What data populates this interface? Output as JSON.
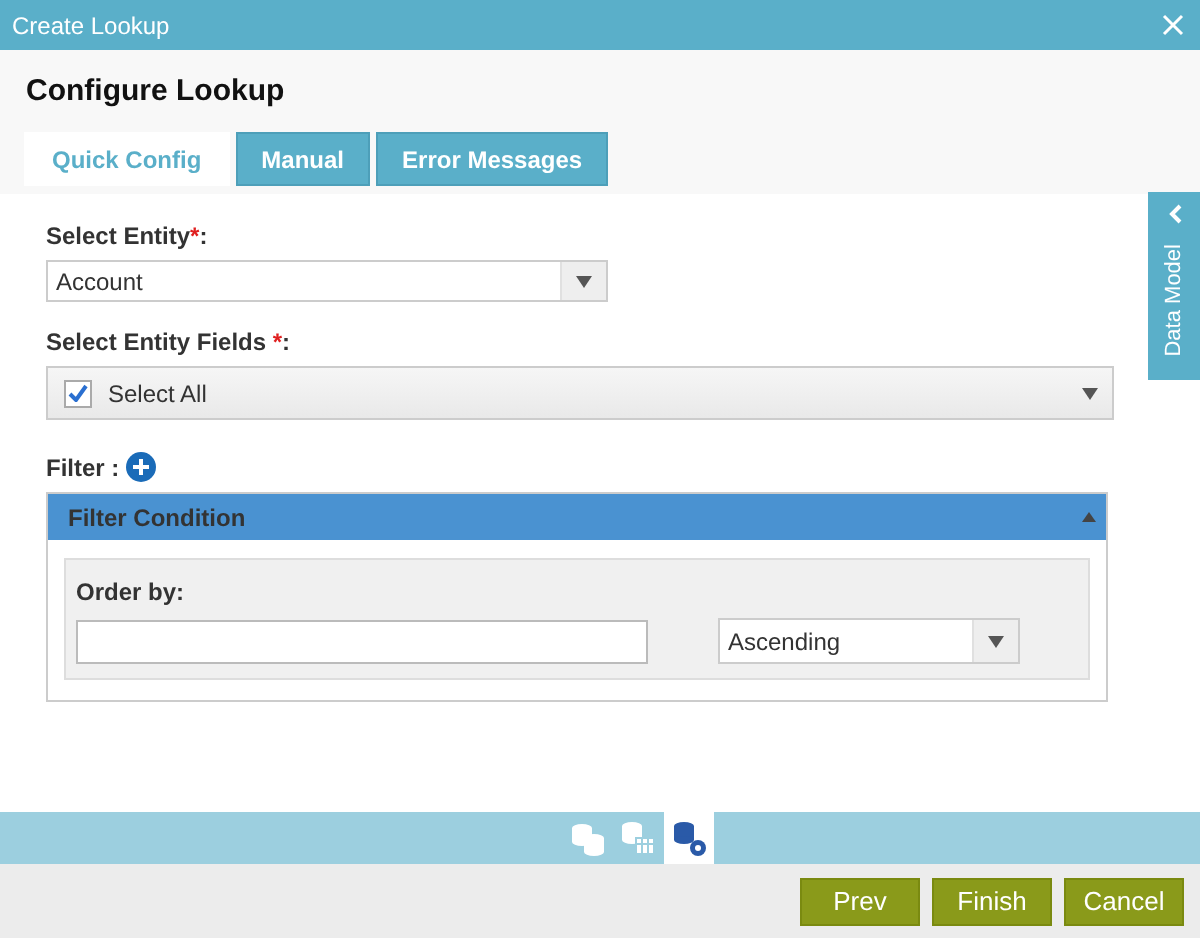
{
  "window": {
    "title": "Create Lookup"
  },
  "heading": "Configure Lookup",
  "tabs": [
    {
      "label": "Quick Config",
      "selected": true
    },
    {
      "label": "Manual",
      "selected": false
    },
    {
      "label": "Error Messages",
      "selected": false
    }
  ],
  "side_panel": {
    "label": "Data Model"
  },
  "entity": {
    "label": "Select Entity",
    "mark": "*",
    "suffix": ":",
    "value": "Account"
  },
  "entity_fields": {
    "label": "Select Entity Fields",
    "mark": "*",
    "suffix": ":",
    "select_all": {
      "label": "Select All",
      "checked": true
    }
  },
  "filter": {
    "label": "Filter :"
  },
  "filter_condition": {
    "title": "Filter Condition",
    "expanded": true,
    "order_by": {
      "label": "Order by:"
    },
    "sort": {
      "value": "Ascending"
    }
  },
  "steps": [
    {
      "kind": "entities",
      "selected": false
    },
    {
      "kind": "entity-table",
      "selected": false
    },
    {
      "kind": "entity-settings",
      "selected": true
    }
  ],
  "buttons": [
    "Prev",
    "Finish",
    "Cancel"
  ]
}
